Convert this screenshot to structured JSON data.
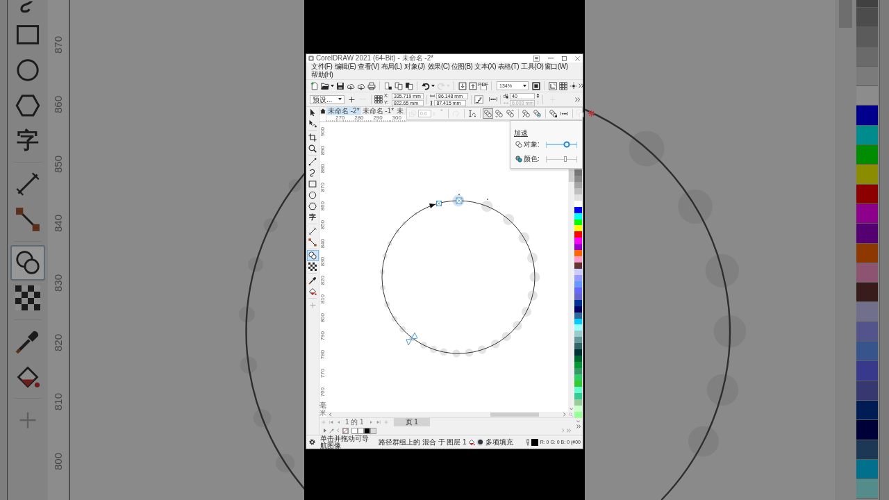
{
  "background_left": {
    "toolbox_groups": [
      {
        "tools": [
          {
            "kind": "curve",
            "selected": false
          },
          {
            "kind": "rectangle",
            "selected": false
          },
          {
            "kind": "ellipse",
            "selected": false
          },
          {
            "kind": "polygon",
            "selected": false
          },
          {
            "kind": "text",
            "label": "字",
            "selected": false
          }
        ]
      },
      {
        "tools": [
          {
            "kind": "line",
            "selected": false
          },
          {
            "kind": "connector",
            "selected": false
          }
        ]
      },
      {
        "tools": [
          {
            "kind": "blend",
            "selected": true
          },
          {
            "kind": "transparency",
            "selected": false
          }
        ]
      },
      {
        "tools": [
          {
            "kind": "eyedropper",
            "selected": false
          },
          {
            "kind": "fill",
            "selected": false
          }
        ]
      },
      {
        "tools": [
          {
            "kind": "add",
            "selected": false
          }
        ]
      }
    ],
    "ruler_labels": [
      "870",
      "860",
      "850",
      "840",
      "830",
      "820",
      "810",
      "800"
    ]
  },
  "window": {
    "title": "CorelDRAW 2021 (64-Bit) - 未命名 -2*",
    "menu": [
      "文件(F)",
      "编辑(E)",
      "查看(V)",
      "布局(L)",
      "对象(J)",
      "效果(C)",
      "位图(B)",
      "文本(X)",
      "表格(T)",
      "工具(O)",
      "窗口(W)",
      "帮助(H)"
    ],
    "standard_toolbar": [
      {
        "items": [
          {
            "kind": "new",
            "disabled": false
          },
          {
            "kind": "open",
            "disabled": false
          },
          {
            "kind": "caret",
            "disabled": false
          },
          {
            "kind": "save",
            "disabled": false
          },
          {
            "kind": "upload",
            "disabled": false
          },
          {
            "kind": "download",
            "disabled": false
          },
          {
            "kind": "print",
            "disabled": false
          }
        ]
      },
      {
        "items": [
          {
            "kind": "cut",
            "disabled": false
          },
          {
            "kind": "copy",
            "disabled": false
          },
          {
            "kind": "paste",
            "disabled": false
          }
        ]
      },
      {
        "items": [
          {
            "kind": "undo",
            "disabled": false
          },
          {
            "kind": "caret",
            "disabled": false
          },
          {
            "kind": "redo",
            "disabled": true
          },
          {
            "kind": "caret",
            "disabled": true
          }
        ]
      },
      {
        "items": [
          {
            "kind": "import",
            "disabled": false
          },
          {
            "kind": "export",
            "disabled": false
          },
          {
            "kind": "pdf",
            "label": "PDF",
            "disabled": false
          }
        ]
      },
      {
        "items": [
          {
            "kind": "zoom_combo",
            "value": "134%",
            "disabled": false
          },
          {
            "kind": "fullscreen",
            "disabled": false
          }
        ]
      },
      {
        "items": [
          {
            "kind": "options",
            "disabled": false
          },
          {
            "kind": "grid",
            "disabled": false
          },
          {
            "kind": "snap",
            "disabled": false
          }
        ]
      }
    ],
    "property_bar": {
      "preset": "预设...",
      "preset_buttons": [
        {
          "kind": "add",
          "disabled": false
        },
        {
          "kind": "remove",
          "disabled": true
        }
      ],
      "position": [
        {
          "label": "X:",
          "value": "335.719 mm"
        },
        {
          "label": "Y:",
          "value": "822.65 mm"
        }
      ],
      "size": [
        "86.148 mm",
        "87.415 mm"
      ],
      "blend_fields": [
        {
          "value": "40",
          "disabled": false
        },
        {
          "value": "6.003 mm",
          "disabled": true
        }
      ],
      "extra_buttons": [
        {
          "kind": "add",
          "disabled": true
        }
      ]
    },
    "toolbox_groups": [
      {
        "tools": [
          {
            "kind": "pick",
            "selected": false
          },
          {
            "kind": "shape",
            "selected": false
          }
        ]
      },
      {
        "tools": [
          {
            "kind": "crop",
            "selected": false
          },
          {
            "kind": "zoom",
            "selected": false
          }
        ]
      },
      {
        "tools": [
          {
            "kind": "freehand",
            "selected": false
          },
          {
            "kind": "curve",
            "selected": false
          },
          {
            "kind": "rectangle",
            "selected": false
          },
          {
            "kind": "ellipse",
            "selected": false
          },
          {
            "kind": "polygon",
            "selected": false
          },
          {
            "kind": "text",
            "label": "字",
            "selected": false
          }
        ]
      },
      {
        "tools": [
          {
            "kind": "line",
            "selected": false
          },
          {
            "kind": "connector",
            "selected": false
          }
        ]
      },
      {
        "tools": [
          {
            "kind": "blend",
            "selected": true
          },
          {
            "kind": "transparency",
            "selected": false
          }
        ]
      },
      {
        "tools": [
          {
            "kind": "eyedropper",
            "selected": false
          },
          {
            "kind": "fill",
            "selected": false
          }
        ]
      },
      {
        "tools": [
          {
            "kind": "add",
            "selected": false
          }
        ]
      }
    ],
    "document_tabs": [
      {
        "label": "未命名 -2*",
        "selected": true
      },
      {
        "label": "未命名 -1*",
        "selected": false
      },
      {
        "label": "未",
        "selected": false
      }
    ],
    "blend_toolbar": {
      "angle": {
        "value": "0.0",
        "unit": "°",
        "disabled": true
      },
      "groups": [
        {
          "items": [
            {
              "kind": "loop",
              "disabled": true,
              "selected": false
            }
          ]
        },
        {
          "items": [
            {
              "kind": "path",
              "disabled": false,
              "selected": false
            }
          ]
        },
        {
          "items": [
            {
              "kind": "direct",
              "disabled": false,
              "selected": true
            },
            {
              "kind": "clockwise",
              "disabled": false,
              "selected": false
            },
            {
              "kind": "counterclockwise",
              "disabled": false,
              "selected": false
            }
          ]
        },
        {
          "items": [
            {
              "kind": "object_accel",
              "disabled": false,
              "selected": false
            },
            {
              "kind": "color_accel",
              "disabled": false,
              "selected": false
            }
          ]
        },
        {
          "items": [
            {
              "kind": "start_end",
              "disabled": false,
              "selected": false
            },
            {
              "kind": "spacing",
              "disabled": false,
              "selected": false
            }
          ]
        },
        {
          "items": [
            {
              "kind": "copy_props",
              "disabled": true,
              "selected": false
            },
            {
              "kind": "clear",
              "disabled": false,
              "selected": false
            }
          ]
        }
      ]
    },
    "horizontal_ruler": [
      "270",
      "280",
      "290",
      "300"
    ],
    "vertical_ruler": [
      "900",
      "890",
      "880",
      "870",
      "860",
      "850",
      "840",
      "830",
      "820",
      "810",
      "800",
      "790",
      "780",
      "770",
      "760"
    ],
    "ruler_unit": "毫米",
    "acceleration_panel": {
      "title": "加速",
      "sliders": [
        {
          "label": "对象:",
          "level": 0.67,
          "disabled": false
        },
        {
          "label": "颜色:",
          "level": 0.62,
          "disabled": true
        }
      ]
    },
    "palette": [
      {
        "color": "#777777"
      },
      {
        "color": "#8a8a8a"
      },
      {
        "color": "#a5a5a5"
      },
      {
        "color": "#c0c0c0"
      },
      {
        "color": "#e0e0e0"
      },
      {
        "color": "#ffffff"
      },
      {
        "color": "#0000ff"
      },
      {
        "color": "#00ffff"
      },
      {
        "color": "#00ff00"
      },
      {
        "color": "#ffff00"
      },
      {
        "color": "#ff0000"
      },
      {
        "color": "#ff00ff"
      },
      {
        "color": "#9900cc"
      },
      {
        "color": "#ff6600"
      },
      {
        "color": "#ff99cc"
      },
      {
        "color": "#663333"
      },
      {
        "color": "#ccccff"
      },
      {
        "color": "#9999ff"
      },
      {
        "color": "#6699ff"
      },
      {
        "color": "#6666ff"
      },
      {
        "color": "#6666cc"
      },
      {
        "color": "#003399"
      },
      {
        "color": "#000066"
      },
      {
        "color": "#336699"
      },
      {
        "color": "#00ccff"
      },
      {
        "color": "#99ffff"
      },
      {
        "color": "#99cccc"
      },
      {
        "color": "#669999"
      },
      {
        "color": "#336666"
      },
      {
        "color": "#003333"
      },
      {
        "color": "#006633"
      },
      {
        "color": "#009933"
      },
      {
        "color": "#339966"
      },
      {
        "color": "#33cc66"
      },
      {
        "color": "#33cc33"
      },
      {
        "color": "#66ffcc"
      },
      {
        "color": "#33cc99"
      },
      {
        "color": "#99cc99"
      },
      {
        "color": "#ccffcc"
      },
      {
        "color": "#99ff99"
      }
    ],
    "page_navigator": {
      "position": "1 的 1",
      "pages": [
        {
          "label": "页 1",
          "selected": true
        }
      ]
    },
    "document_palette": [
      {
        "kind": "none"
      },
      {
        "kind": "swatch",
        "color": "#ffffff"
      },
      {
        "kind": "swatch",
        "color": "#ffffff"
      },
      {
        "kind": "swatch",
        "color": "#000000"
      },
      {
        "kind": "swatch",
        "color": "#dcdcdc"
      }
    ],
    "status_bar": {
      "hint": "单击并拖动可导航图像",
      "selection": "路径群组上的 混合 于 图层 1",
      "fill": "多项填充",
      "outline_swatch": {
        "color": "#000000"
      },
      "color_readout": "R: 0 G: 0 B: 0 (#00"
    }
  },
  "background_right": {
    "palette": [
      {
        "color": "#414141"
      },
      {
        "color": "#4c4c4c"
      },
      {
        "color": "#5b5b5b"
      },
      {
        "color": "#6a6a6a"
      },
      {
        "color": "#7b7b7b"
      },
      {
        "color": "#8c8c8c"
      },
      {
        "color": "#00008c"
      },
      {
        "color": "#008c8c"
      },
      {
        "color": "#008c00"
      },
      {
        "color": "#8c8c00"
      },
      {
        "color": "#8c0000"
      },
      {
        "color": "#8c008c"
      },
      {
        "color": "#540070"
      },
      {
        "color": "#8c3800"
      },
      {
        "color": "#8c5470"
      },
      {
        "color": "#381c1c"
      },
      {
        "color": "#70708c"
      },
      {
        "color": "#54548c"
      },
      {
        "color": "#38548c"
      },
      {
        "color": "#38388c"
      },
      {
        "color": "#383870"
      },
      {
        "color": "#001c54"
      },
      {
        "color": "#000038"
      },
      {
        "color": "#1c3854"
      },
      {
        "color": "#00708c"
      },
      {
        "color": "#548c8c"
      }
    ]
  }
}
